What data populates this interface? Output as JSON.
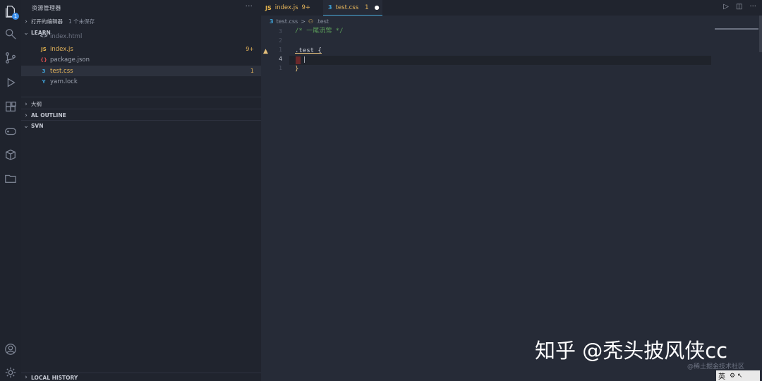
{
  "explorer": {
    "title": "资源管理器",
    "more": "···",
    "open_editors": {
      "label": "打开的编辑器",
      "sub": "1 个未保存"
    },
    "project": "LEARN",
    "files": [
      {
        "icon": "<>",
        "name": "index.html",
        "count": "",
        "color": "#e37933"
      },
      {
        "icon": "JS",
        "name": "index.js",
        "count": "9+",
        "color": "#e8b64c"
      },
      {
        "icon": "{}",
        "name": "package.json",
        "count": "",
        "color": "#cf4d4d"
      },
      {
        "icon": "3",
        "name": "test.css",
        "count": "1",
        "color": "#3fa3d8"
      },
      {
        "icon": "Y",
        "name": "yarn.lock",
        "count": "",
        "color": "#3fa3d8"
      }
    ],
    "sections": [
      "大纲",
      "AL OUTLINE",
      "SVN"
    ],
    "bottom_section": "LOCAL HISTORY"
  },
  "activity_badge": "1",
  "tabs": [
    {
      "icon": "JS",
      "label": "index.js",
      "count": "9+",
      "color": "#e8b64c"
    },
    {
      "icon": "3",
      "label": "test.css",
      "count": "1",
      "color": "#3fa3d8",
      "dirty": "●"
    }
  ],
  "tab_actions": [
    "▷",
    "◫",
    "···"
  ],
  "breadcrumb": {
    "file": "test.css",
    "sep": ">",
    "symbol": ".test"
  },
  "editor": {
    "line_numbers": [
      "3",
      "2",
      "1",
      "4",
      "1",
      "2"
    ],
    "lines": [
      {
        "text": "/* 一尾流莺 */",
        "color": "#5c9f5a"
      },
      {
        "text": "",
        "color": "#c9cdd6"
      },
      {
        "text": ".test {",
        "color": "#c9cdd6"
      },
      {
        "text": "  |",
        "color": "#c9cdd6"
      },
      {
        "text": "}",
        "color": "#e5c07b"
      }
    ]
  },
  "watermark": {
    "main": "知乎 @秃头披风侠cc",
    "sub": "@稀土掘金技术社区"
  },
  "ime": {
    "label": "英",
    "icons": "⚙ ↖"
  }
}
